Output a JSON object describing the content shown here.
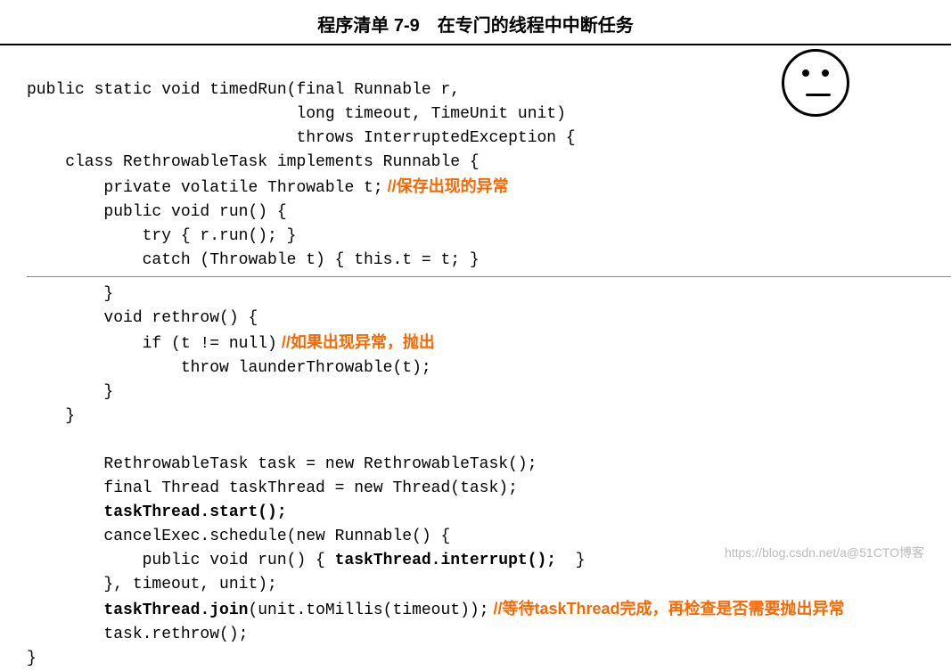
{
  "title": "程序清单 7-9　在专门的线程中中断任务",
  "code": {
    "l1": "public static void timedRun(final Runnable r,",
    "l2": "                            long timeout, TimeUnit unit)",
    "l3": "                            throws InterruptedException {",
    "l4": "    class RethrowableTask implements Runnable {",
    "l5": "        private volatile Throwable t;",
    "l5c": " //保存出现的异常",
    "l6": "        public void run() {",
    "l7": "            try { r.run(); }",
    "l8": "            catch (Throwable t) { this.t = t; }",
    "l9": "        }",
    "l10": "        void rethrow() {",
    "l11": "            if (t != null)",
    "l11c": " //如果出现异常，抛出",
    "l12": "                throw launderThrowable(t);",
    "l13": "        }",
    "l14": "    }",
    "l15": "",
    "l16": "        RethrowableTask task = new RethrowableTask();",
    "l17": "        final Thread taskThread = new Thread(task);",
    "l18": "        taskThread.start();",
    "l19": "        cancelExec.schedule(new Runnable() {",
    "l20a": "            public void run() { ",
    "l20b": "taskThread.interrupt();",
    "l20c": "  }",
    "l21": "        }, timeout, unit);",
    "l22a": "        ",
    "l22b": "taskThread.join",
    "l22c": "(unit.toMillis(timeout));",
    "l22cm": " //等待taskThread完成，再检查是否需要抛出异常",
    "l23": "        task.rethrow();",
    "l24": "}"
  },
  "watermark": "https://blog.csdn.net/a@51CTO博客"
}
